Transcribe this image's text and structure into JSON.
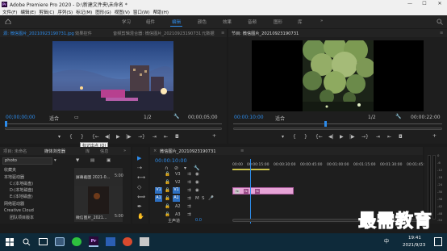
{
  "window": {
    "title": "Adobe Premiere Pro 2020 - D:\\新建文件夹\\未命名 *",
    "minimize_icon": "—",
    "maximize_icon": "☐",
    "close_icon": "✕"
  },
  "menu": {
    "items": [
      "文件(F)",
      "编辑(E)",
      "剪辑(C)",
      "序列(S)",
      "标记(M)",
      "图形(G)",
      "视图(V)",
      "窗口(W)",
      "帮助(H)"
    ]
  },
  "workspaces": {
    "home_icon": "home-icon",
    "items": [
      "学习",
      "组件",
      "编辑",
      "颜色",
      "效果",
      "音频",
      "图形",
      "库"
    ],
    "active": "编辑",
    "more": "»"
  },
  "source_monitor": {
    "tabs": [
      "源: 微信图片_20210923190731.jpg",
      "效果控件",
      "音频剪辑混合器: 微信图片_20210923190731",
      "元数据"
    ],
    "more": "≡",
    "timecode": "00;00;00;00",
    "fit": "适合",
    "fraction": "1/2",
    "duration": "00;00;05;00",
    "wrench_icon": "wrench-icon"
  },
  "program_monitor": {
    "tab": "节目: 微信图片_20210923190731",
    "more": "≡",
    "timecode": "00:00:10:00",
    "fit": "适合",
    "fraction": "1/2",
    "duration": "00:00:22:00",
    "wrench_icon": "wrench-icon"
  },
  "transport": {
    "marker": "▾",
    "in": "{",
    "out": "}",
    "go_in": "{←",
    "step_back": "◀|",
    "play": "▶",
    "step_fwd": "|▶",
    "go_out": "→}",
    "insert": "⇥",
    "overwrite": "⇤",
    "export_frame": "◘",
    "add": "+"
  },
  "tooltip": {
    "text": "标记出点 (O)"
  },
  "project_panel": {
    "tabs": [
      "项目: 未命名",
      "媒体浏览器",
      "库",
      "信息"
    ],
    "active_tab": "媒体浏览器",
    "more": "»",
    "search_value": "photo",
    "tree": [
      {
        "label": "收藏夹",
        "indent": 0
      },
      {
        "label": "本地驱动器",
        "indent": 0
      },
      {
        "label": "C:(本地磁盘)",
        "indent": 1
      },
      {
        "label": "D:(本地磁盘)",
        "indent": 1
      },
      {
        "label": "E:(本地磁盘)",
        "indent": 1
      },
      {
        "label": "网络驱动器",
        "indent": 0
      },
      {
        "label": "Creative Cloud",
        "indent": 0
      },
      {
        "label": "团队项目版本",
        "indent": 1
      }
    ],
    "thumbs": [
      {
        "name": "屏幕截图 2021-0...",
        "duration": "5:00"
      },
      {
        "name": "微信图片_2021...",
        "duration": "5:00"
      }
    ]
  },
  "timeline": {
    "close": "×",
    "sequence_name": "微信图片_20210923190731",
    "more": "≡",
    "timecode": "00:00:10:00",
    "ruler": [
      "00:00",
      "00:00:15:00",
      "00:00:30:00",
      "00:00:45:00",
      "00:01:00:00",
      "00:01:15:00",
      "00:01:30:00",
      "00:01:45:00"
    ],
    "tracks": [
      {
        "source": "",
        "name": "V3"
      },
      {
        "source": "",
        "name": "V2"
      },
      {
        "source": "V1",
        "name": "V1"
      },
      {
        "source": "A1",
        "name": "A1"
      },
      {
        "source": "",
        "name": "A2"
      },
      {
        "source": "",
        "name": "A3"
      }
    ],
    "master_label": "主声道",
    "master_value": "0.0",
    "clip_labels": [
      "fx",
      "fx",
      "fx"
    ],
    "fx_glyph": "fx"
  },
  "meters": {
    "labels": [
      "0",
      "-6",
      "-12",
      "-18",
      "-24",
      "-30",
      "-36",
      "-42",
      "-48",
      "-54"
    ]
  },
  "taskbar": {
    "time": "19:41",
    "date": "2021/9/23",
    "ime": "中"
  },
  "watermark": {
    "text": "最需教育"
  }
}
